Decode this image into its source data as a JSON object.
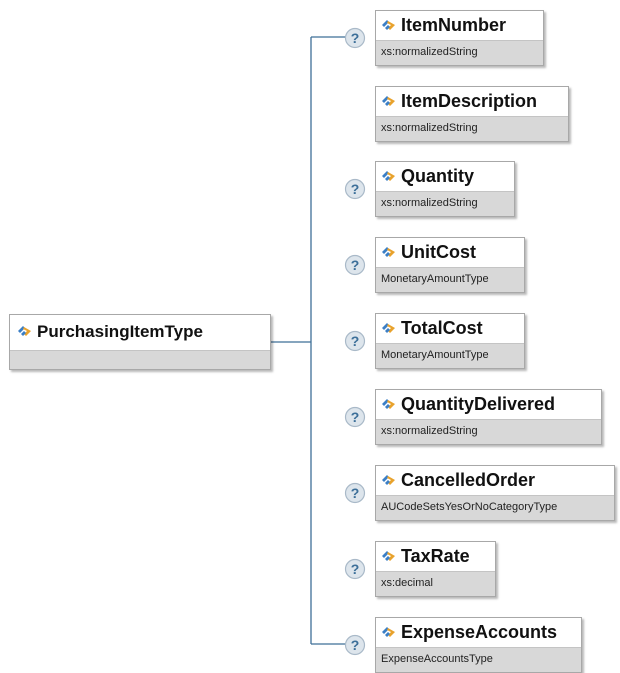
{
  "root": {
    "name": "PurchasingItemType"
  },
  "elements": [
    {
      "name": "ItemNumber",
      "type": "xs:normalizedString",
      "optional": true
    },
    {
      "name": "ItemDescription",
      "type": "xs:normalizedString",
      "optional": false
    },
    {
      "name": "Quantity",
      "type": "xs:normalizedString",
      "optional": true
    },
    {
      "name": "UnitCost",
      "type": "MonetaryAmountType",
      "optional": true
    },
    {
      "name": "TotalCost",
      "type": "MonetaryAmountType",
      "optional": true
    },
    {
      "name": "QuantityDelivered",
      "type": "xs:normalizedString",
      "optional": true
    },
    {
      "name": "CancelledOrder",
      "type": "AUCodeSetsYesOrNoCategoryType",
      "optional": true
    },
    {
      "name": "TaxRate",
      "type": "xs:decimal",
      "optional": true
    },
    {
      "name": "ExpenseAccounts",
      "type": "ExpenseAccountsType",
      "optional": true
    }
  ],
  "colors": {
    "connector": "#3f6f97",
    "optional_circle": "#dde5ec",
    "optional_mark": "#3c6f99",
    "icon_blue": "#3b7fc6",
    "icon_gold": "#e8a22c",
    "type_band": "#d8d8d8"
  }
}
